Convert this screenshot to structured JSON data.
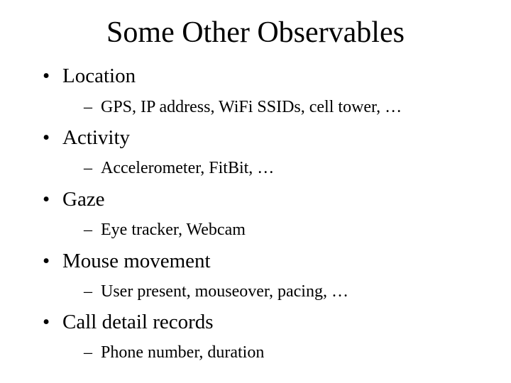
{
  "slide": {
    "title": "Some Other Observables",
    "bullet_glyph": "•",
    "dash_glyph": "–",
    "items": [
      {
        "label": "Location",
        "sub": "GPS, IP address, WiFi SSIDs, cell tower, …"
      },
      {
        "label": "Activity",
        "sub": "Accelerometer, FitBit, …"
      },
      {
        "label": "Gaze",
        "sub": "Eye tracker, Webcam"
      },
      {
        "label": "Mouse movement",
        "sub": "User present, mouseover, pacing, …"
      },
      {
        "label": "Call detail records",
        "sub": "Phone number, duration"
      }
    ]
  }
}
